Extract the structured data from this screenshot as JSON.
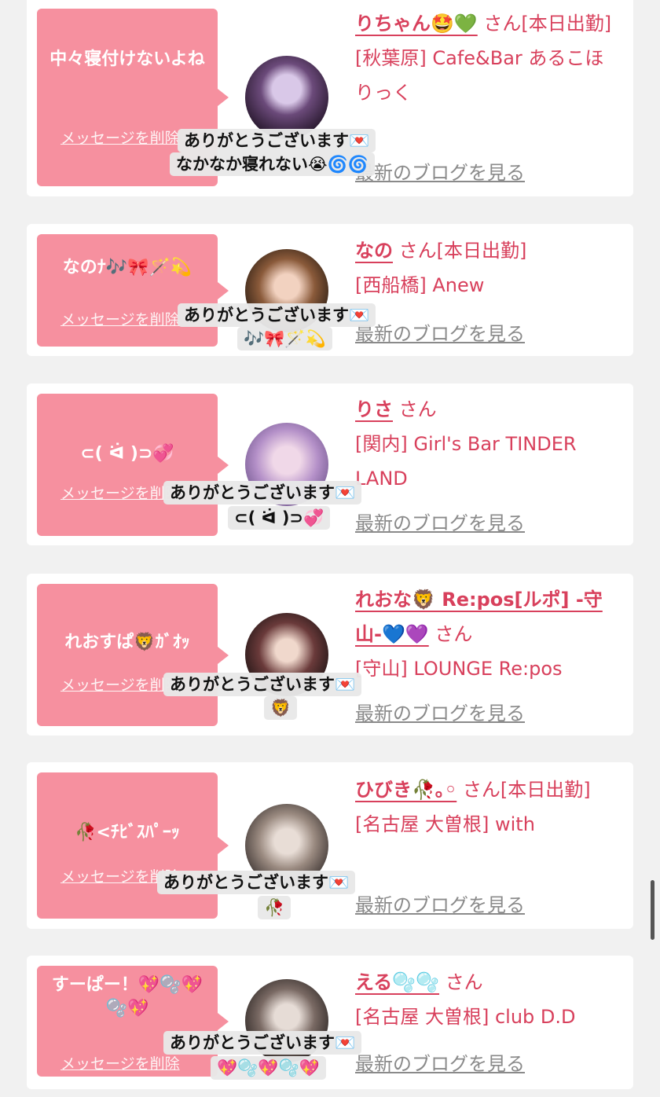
{
  "cards": [
    {
      "bubble_text": "中々寝付けないよね",
      "delete_label": "メッセージを削除",
      "name": "りちゃん🤩💚",
      "suffix": "さん[本日出勤]",
      "shop": "[秋葉原] Cafe&Bar あるこほりっく",
      "blog_label": "最新のブログを見る",
      "toast_line1": "ありがとうございます💌",
      "toast_line2": "なかなか寝れない😭🌀🌀"
    },
    {
      "bubble_text": "なのﾅ🎶🎀🪄💫",
      "delete_label": "メッセージを削除",
      "name": "なの",
      "suffix": "さん[本日出勤]",
      "shop": "[西船橋] Anew",
      "blog_label": "最新のブログを見る",
      "toast_line1": "ありがとうございます💌",
      "toast_line2": "🎶🎀🪄💫"
    },
    {
      "bubble_text": "⊂( ᐛ )⊃💞",
      "delete_label": "メッセージを削除",
      "name": "りさ",
      "suffix": "さん",
      "shop": "[関内] Girl's Bar TINDER LAND",
      "blog_label": "最新のブログを見る",
      "toast_line1": "ありがとうございます💌",
      "toast_line2": "⊂( ᐛ )⊃💞"
    },
    {
      "bubble_text": "れおすぱ🦁ｶﾞｵｯ",
      "delete_label": "メッセージを削除",
      "name": "れおな🦁 Re:pos[ルポ] -守山-💙💜",
      "suffix": "さん",
      "shop": "[守山] LOUNGE Re:pos",
      "blog_label": "最新のブログを見る",
      "toast_line1": "ありがとうございます💌",
      "toast_line2": "🦁"
    },
    {
      "bubble_text": "🥀<ﾁﾋﾞｽﾊﾟｰｯ",
      "delete_label": "メッセージを削除",
      "name": "ひびき🥀｡◦",
      "suffix": "さん[本日出勤]",
      "shop": "[名古屋 大曽根] with",
      "blog_label": "最新のブログを見る",
      "toast_line1": "ありがとうございます💌",
      "toast_line2": "🥀"
    },
    {
      "bubble_text": "すーぱー！💖🫧💖🫧💖",
      "delete_label": "メッセージを削除",
      "name": "える🫧🫧",
      "suffix": "さん",
      "shop": "[名古屋 大曽根] club D.D",
      "blog_label": "最新のブログを見る",
      "toast_line1": "ありがとうございます💌",
      "toast_line2": "💖🫧💖🫧💖"
    }
  ],
  "colors": {
    "accent": "#d8405c",
    "bubble": "#f6909f",
    "background": "#f1f1f1",
    "link_gray": "#8a8a8a"
  }
}
